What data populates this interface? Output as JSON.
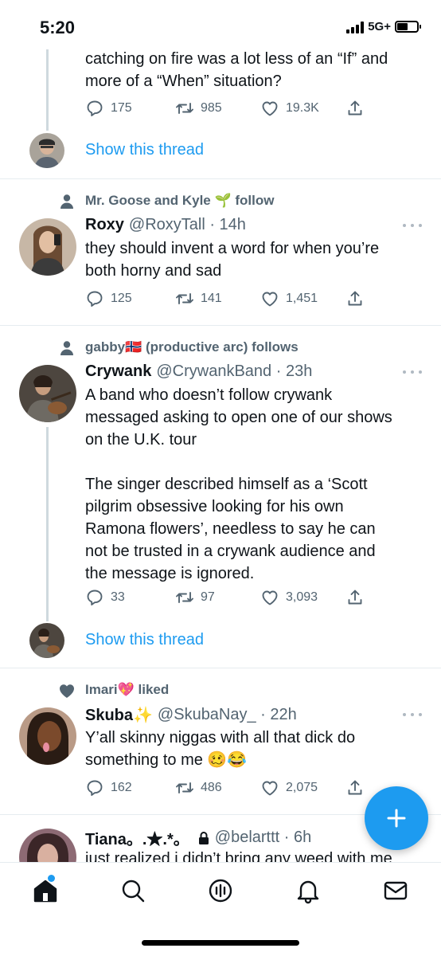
{
  "status_bar": {
    "time": "5:20",
    "network": "5G+"
  },
  "tweet0": {
    "text_tail": "catching on fire was a lot less of an “If” and\nmore of a “When” situation?",
    "replies": "175",
    "retweets": "985",
    "likes": "19.3K",
    "show_thread": "Show this thread"
  },
  "tweet1": {
    "social_context": "Mr. Goose and Kyle 🌱 follow",
    "name": "Roxy",
    "handle": "@RoxyTall · 14h",
    "text": "they should invent a word for when you’re\nboth horny and sad",
    "replies": "125",
    "retweets": "141",
    "likes": "1,451"
  },
  "tweet2": {
    "social_context": "gabby🇳🇴 (productive arc) follows",
    "name": "Crywank",
    "handle": "@CrywankBand · 23h",
    "text": "A band who doesn’t follow crywank\nmessaged asking to open one of our shows\non the U.K. tour\n\nThe singer described himself as a ‘Scott\npilgrim obsessive looking for his own\nRamona flowers’, needless to say he can\nnot be trusted in a crywank audience and\nthe message is ignored.",
    "replies": "33",
    "retweets": "97",
    "likes": "3,093",
    "show_thread": "Show this thread"
  },
  "tweet3": {
    "social_context": "Imari💖 liked",
    "name": "Skuba✨",
    "handle": "@SkubaNay_ · 22h",
    "text": "Y’all skinny niggas with all that dick do\nsomething to me 🥴😂",
    "replies": "162",
    "retweets": "486",
    "likes": "2,075"
  },
  "tweet4": {
    "name": "Tiana。.★.*。",
    "handle": "@belarttt · 6h",
    "text": "just realized i didn’t bring any weed with me"
  },
  "colors": {
    "accent": "#1d9bf0",
    "muted": "#536471",
    "text": "#0f1419"
  },
  "icons": [
    "reply-icon",
    "retweet-icon",
    "like-icon",
    "share-icon",
    "home-icon",
    "search-icon",
    "spaces-icon",
    "notifications-icon",
    "messages-icon",
    "compose-icon"
  ]
}
